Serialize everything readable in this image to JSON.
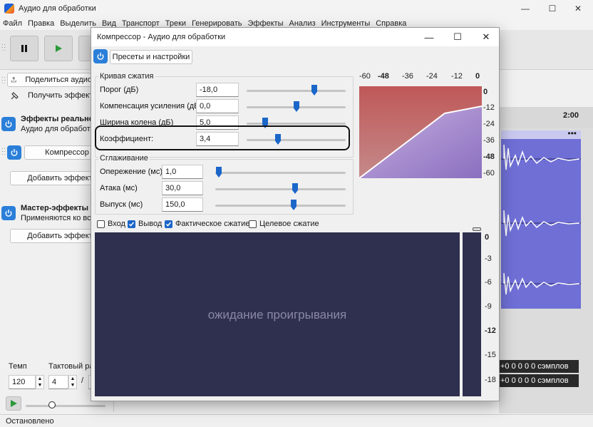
{
  "app": {
    "title": "Аудио для обработки",
    "window_controls": [
      "—",
      "☐",
      "✕"
    ]
  },
  "menu": [
    "Файл",
    "Правка",
    "Выделить",
    "Вид",
    "Транспорт",
    "Треки",
    "Генерировать",
    "Эффекты",
    "Анализ",
    "Инструменты",
    "Справка"
  ],
  "left_panel": {
    "share_label": "Поделиться аудио",
    "get_effects_label": "Получить эффекты",
    "realtime_title": "Эффекты реального времени",
    "realtime_sub": "Аудио для обработки",
    "compressor_button": "Компрессор",
    "add_effect_label": "Добавить эффект",
    "master_title": "Мастер-эффекты",
    "master_sub": "Применяются ко всем",
    "master_add_label": "Добавить эффект",
    "tempo_label": "Темп",
    "tempo_value": "120",
    "meter_label": "Тактовый размер",
    "meter_num": "4",
    "meter_sep": "/",
    "meter_den": "4"
  },
  "timeline": {
    "tick_label": "2:00",
    "selection_1": "+0 0 0 0 0 сэмплов",
    "selection_2": "+0 0 0 0 0 сэмплов"
  },
  "status": "Остановлено",
  "dialog": {
    "title": "Компрессор - Аудио для обработки",
    "presets_label": "Пресеты и настройки",
    "curve_group": "Кривая сжатия",
    "params": [
      {
        "label": "Порог (дБ)",
        "value": "-18,0",
        "level": 0.6
      },
      {
        "label": "Компенсация усиления (дБ)",
        "value": "0,0",
        "level": 0.5
      },
      {
        "label": "Ширина колена (дБ)",
        "value": "5,0",
        "level": 0.18
      },
      {
        "label": "Коэффициент:",
        "value": "3,4",
        "level": 0.28
      }
    ],
    "smooth_group": "Сглаживание",
    "smooth_params": [
      {
        "label": "Опережение (мс)",
        "value": "1,0",
        "level": 0.02
      },
      {
        "label": "Атака (мс)",
        "value": "30,0",
        "level": 0.6
      },
      {
        "label": "Выпуск (мс)",
        "value": "150,0",
        "level": 0.6
      }
    ],
    "top_axis": [
      "-60",
      "-48",
      "-36",
      "-24",
      "-12",
      "0"
    ],
    "right_axis": [
      "0",
      "-12",
      "-24",
      "-36",
      "-48",
      "-60"
    ],
    "checks": [
      {
        "label": "Вход",
        "checked": false
      },
      {
        "label": "Вывод",
        "checked": true
      },
      {
        "label": "Фактическое сжатие",
        "checked": true
      },
      {
        "label": "Целевое сжатие",
        "checked": false
      }
    ],
    "meter_waiting": "ожидание проигрывания",
    "meter_scale": [
      "0",
      "-3",
      "-6",
      "-9",
      "-12",
      "-15",
      "-18"
    ]
  }
}
